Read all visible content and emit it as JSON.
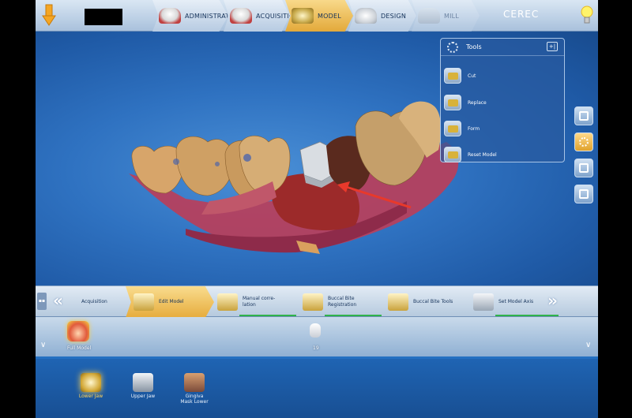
{
  "topbar": {
    "stages": [
      {
        "label": "ADMINISTRATION"
      },
      {
        "label": "ACQUISITION"
      },
      {
        "label": "MODEL"
      },
      {
        "label": "DESIGN"
      },
      {
        "label": "MILL"
      }
    ],
    "brand": "CEREC",
    "active_stage": "MODEL"
  },
  "tools": {
    "title": "Tools",
    "items": [
      {
        "label": "Cut"
      },
      {
        "label": "Replace"
      },
      {
        "label": "Form"
      },
      {
        "label": "Reset Model"
      }
    ]
  },
  "workflow": {
    "steps": [
      {
        "label": "Acquisition"
      },
      {
        "label": "Edit Model"
      },
      {
        "label": "Manual corre-\nlation"
      },
      {
        "label": "Buccal Bite\nRegistration"
      },
      {
        "label": "Buccal Bite Tools"
      },
      {
        "label": "Set Model Axis"
      }
    ],
    "active_step": "Edit Model"
  },
  "thumbs": {
    "full_model_label": "Full Model",
    "tooth_number": "19"
  },
  "library": {
    "items": [
      {
        "label": "Lower Jaw"
      },
      {
        "label": "Upper Jaw"
      },
      {
        "label": "Gingiva\nMask Lower"
      }
    ],
    "active_item": "Lower Jaw"
  },
  "colors": {
    "accent_gold": "#e6ac3d",
    "background_blue": "#1d5fa8",
    "arrow_red": "#e8392b"
  }
}
